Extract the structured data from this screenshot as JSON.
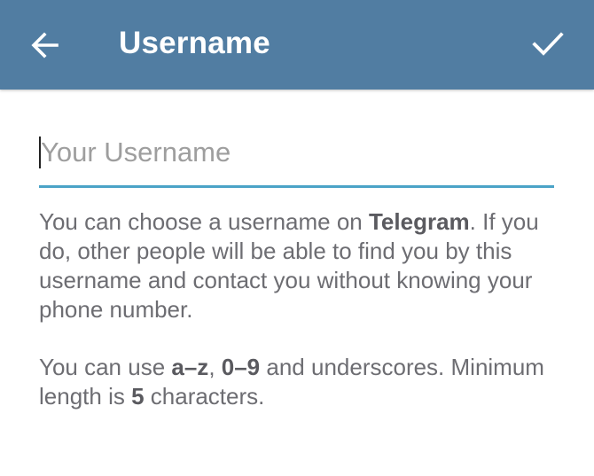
{
  "header": {
    "title": "Username",
    "back_icon": "arrow-left-icon",
    "done_icon": "checkmark-icon",
    "background_color": "#517da2"
  },
  "username_field": {
    "value": "",
    "placeholder": "Your Username",
    "underline_color": "#4ba3c7"
  },
  "help": {
    "p1_part1": "You can choose a username on ",
    "p1_bold": "Telegram",
    "p1_part2": ". If you do, other people will be able to find you by this username and contact you without knowing your phone number.",
    "p2_part1": "You can use ",
    "p2_bold1": "a–z",
    "p2_part2": ", ",
    "p2_bold2": "0–9",
    "p2_part3": " and underscores. Minimum length is ",
    "p2_bold3": "5",
    "p2_part4": " characters."
  }
}
